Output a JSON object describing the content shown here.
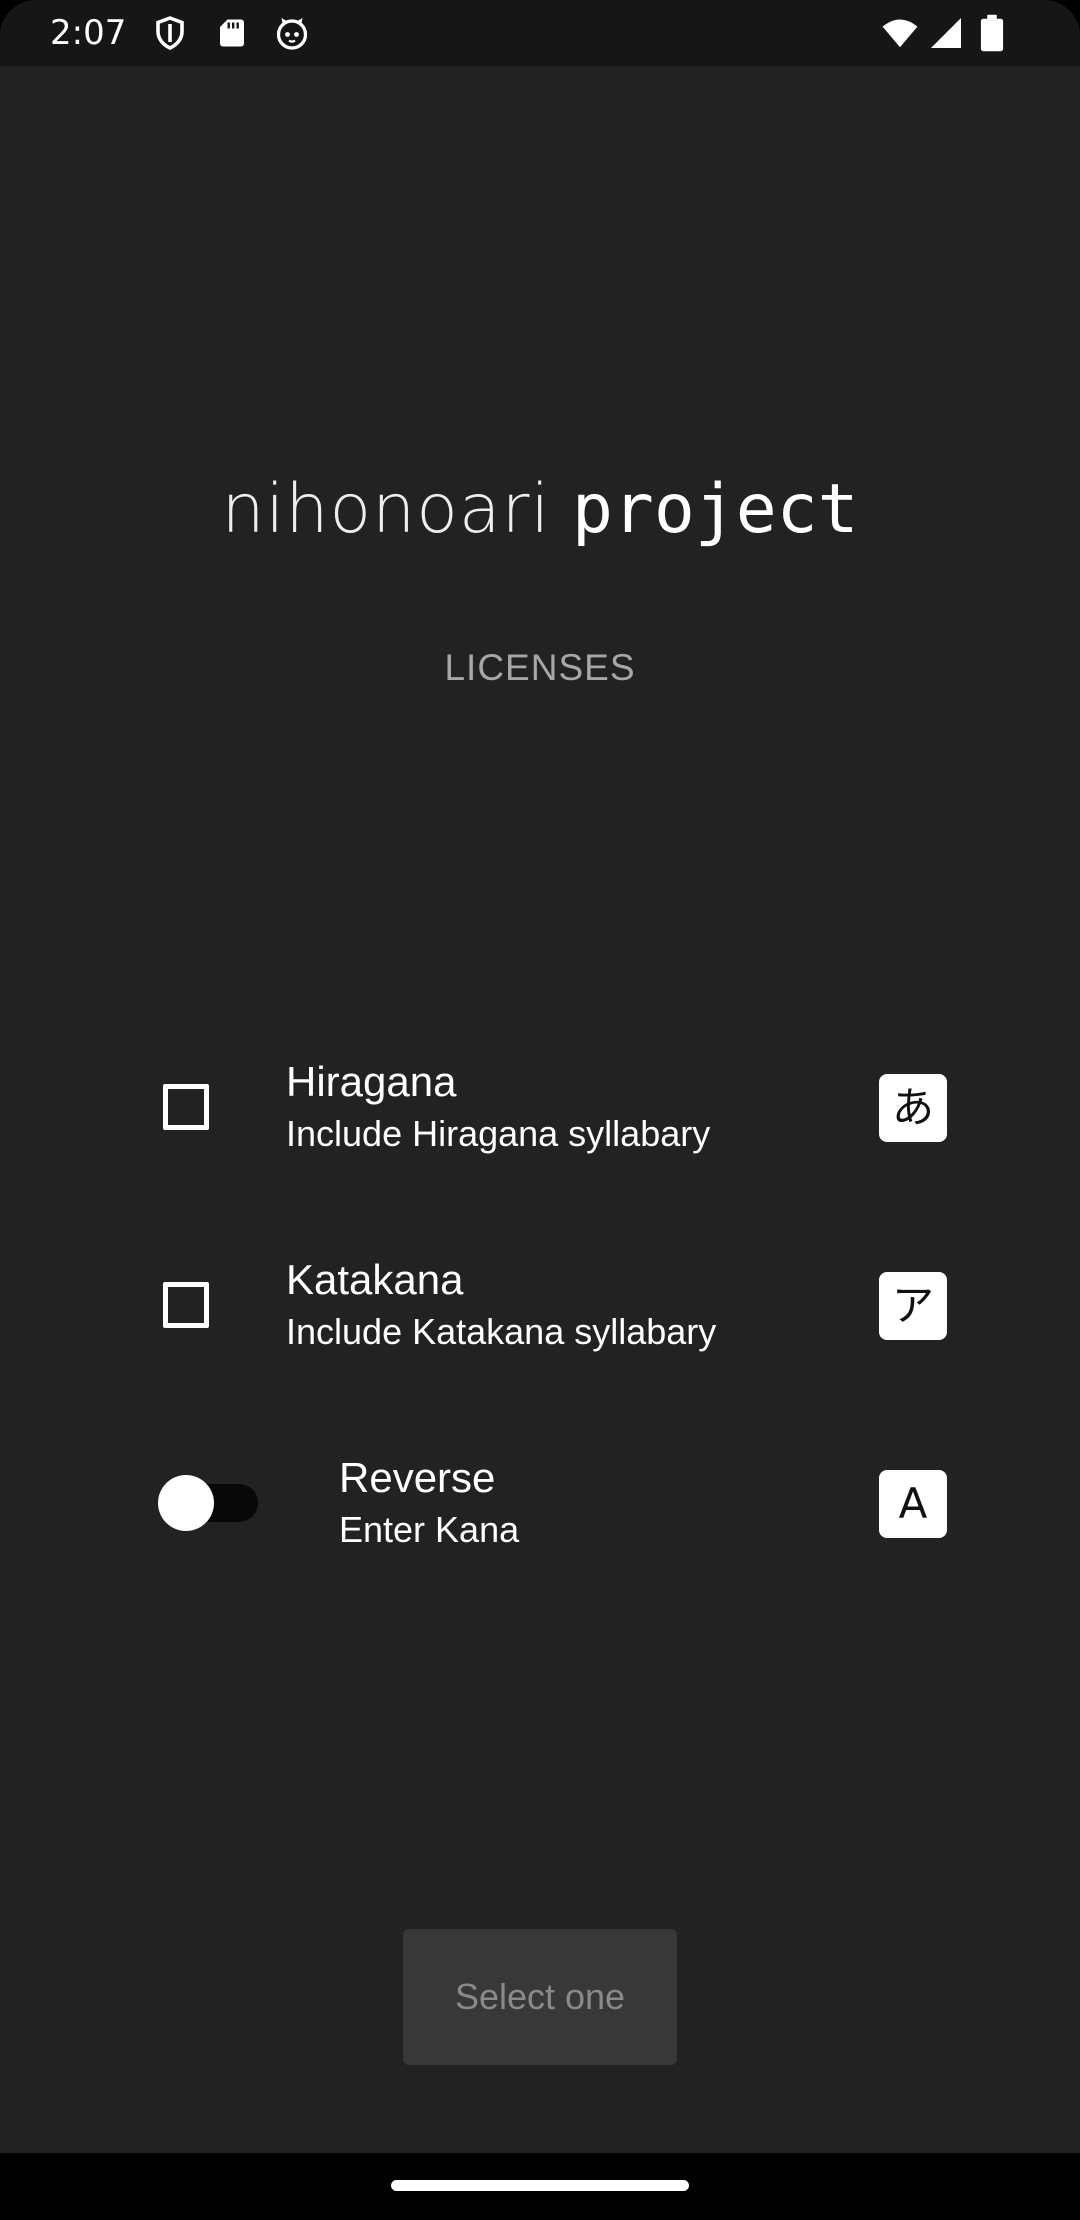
{
  "status_bar": {
    "time": "2:07",
    "left_icons": [
      "shield-icon",
      "sd-card-icon",
      "cat-icon"
    ],
    "right_icons": [
      "wifi-icon",
      "signal-icon",
      "battery-icon"
    ]
  },
  "header": {
    "title_light": "nihonoari",
    "title_bold": "project",
    "licenses_label": "LICENSES"
  },
  "options": {
    "hiragana": {
      "title": "Hiragana",
      "subtitle": "Include Hiragana syllabary",
      "badge": "あ",
      "checked": false
    },
    "katakana": {
      "title": "Katakana",
      "subtitle": "Include Katakana syllabary",
      "badge": "ア",
      "checked": false
    },
    "reverse": {
      "title": "Reverse",
      "subtitle": "Enter Kana",
      "badge": "A",
      "on": false
    }
  },
  "action": {
    "button_label": "Select one",
    "enabled": false
  },
  "colors": {
    "background": "#222222",
    "status_bar": "#161616",
    "button_bg": "#383838",
    "button_text_disabled": "#8a8a8a",
    "licenses_text": "#a7a7a7"
  }
}
